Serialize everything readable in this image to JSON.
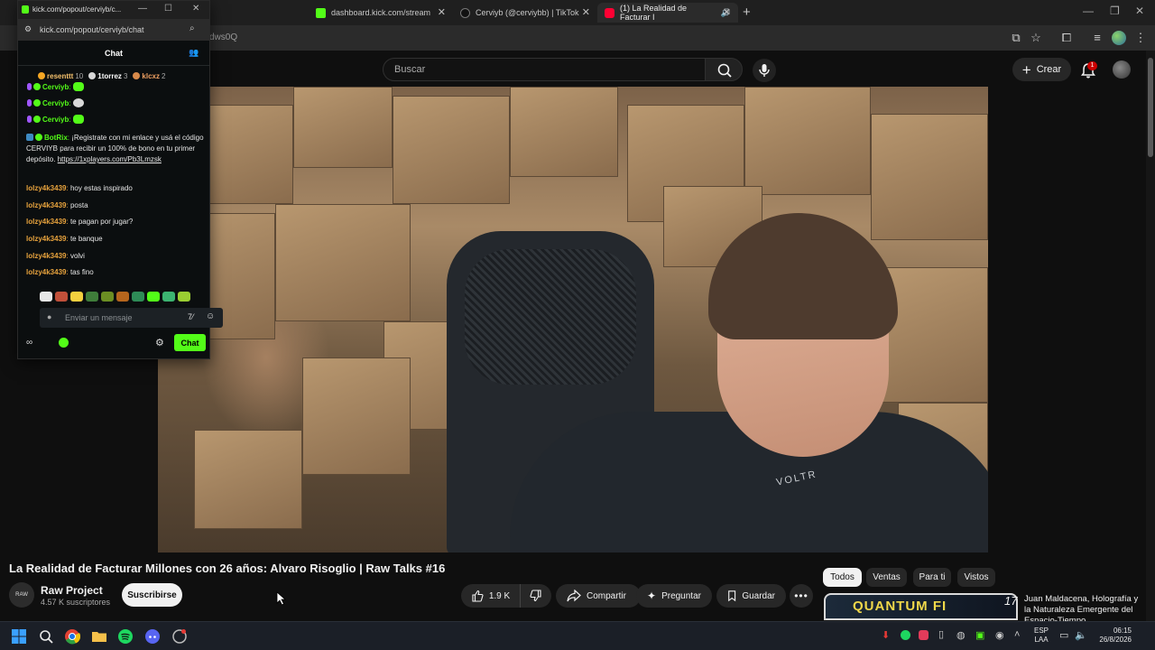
{
  "browser": {
    "tabs": [
      {
        "title": "",
        "favicon": "kick-icon"
      },
      {
        "title": "dashboard.kick.com/stream",
        "favicon": "kick-icon"
      },
      {
        "title": "Cerviyb (@cerviybb) | TikTok",
        "favicon": "tiktok-icon"
      },
      {
        "title": "(1) La Realidad de Facturar I",
        "favicon": "youtube-icon"
      }
    ],
    "url_fragment": "dws0Q"
  },
  "youtube": {
    "search_placeholder": "Buscar",
    "create_label": "Crear",
    "notification_count": "1",
    "video_title": "La Realidad de Facturar Millones con 26 años: Alvaro Risoglio | Raw Talks #16",
    "shirt_logo": "VOLTR",
    "channel": {
      "avatar_text": "RAW",
      "name": "Raw Project",
      "subscribers": "4.57 K suscriptores"
    },
    "subscribe_label": "Suscribirse",
    "actions": {
      "likes": "1.9 K",
      "share": "Compartir",
      "ask": "Preguntar",
      "save": "Guardar"
    },
    "chips": [
      "Todos",
      "Ventas",
      "Para ti",
      "Vistos"
    ],
    "recommendation": {
      "thumb_text": "QUANTUM FI",
      "number": "17",
      "title": "Juan Maldacena, Holografía y la Naturaleza Emergente del Espacio-Tiempo"
    }
  },
  "kick": {
    "window_title": "kick.com/popout/cerviyb/c...",
    "url": "kick.com/popout/cerviyb/chat",
    "chat_title": "Chat",
    "leaderboard": [
      {
        "name": "resenttt",
        "count": "10",
        "color": "#f5a623",
        "text_color": "#f5c16c"
      },
      {
        "name": "1torrez",
        "count": "3",
        "color": "#d8d8d8",
        "text_color": "#ffffff"
      },
      {
        "name": "klcxz",
        "count": "2",
        "color": "#d88a4a",
        "text_color": "#f0a062"
      }
    ],
    "messages": [
      {
        "user": "Cerviyb",
        "text": "",
        "color": "#53fc18"
      },
      {
        "user": "Cerviyb",
        "text": "",
        "color": "#53fc18"
      },
      {
        "user": "Cerviyb",
        "text": "",
        "color": "#53fc18"
      },
      {
        "user": "BotRix",
        "text": " ¡Registrate con mi enlace y usá el código CERVIYB para recibir un 100% de bono en tu primer depósito. ",
        "link": "https://1xplayers.com/Pb3Lmzsk",
        "color": "#53fc18"
      },
      {
        "user": "lolzy4k3439",
        "text": " hoy estas inspirado",
        "color": "#e8a33d"
      },
      {
        "user": "lolzy4k3439",
        "text": " posta",
        "color": "#e8a33d"
      },
      {
        "user": "lolzy4k3439",
        "text": " te pagan por jugar?",
        "color": "#e8a33d"
      },
      {
        "user": "lolzy4k3439",
        "text": " te banque",
        "color": "#e8a33d"
      },
      {
        "user": "lolzy4k3439",
        "text": " volvi",
        "color": "#e8a33d"
      },
      {
        "user": "lolzy4k3439",
        "text": " tas fino",
        "color": "#e8a33d"
      }
    ],
    "input_placeholder": "Enviar un mensaje",
    "send_label": "Chat"
  },
  "taskbar": {
    "lang_line1": "ESP",
    "lang_line2": "LAA",
    "time": "06:15",
    "date": "26/8/2026"
  }
}
